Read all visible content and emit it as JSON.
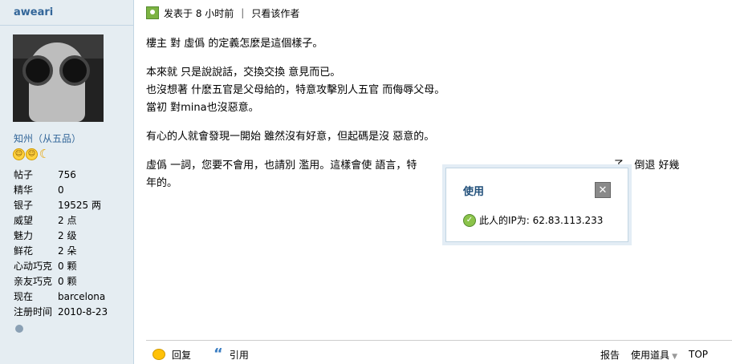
{
  "user": {
    "name": "aweari",
    "rank": "知州（从五品）",
    "stats": [
      {
        "label": "帖子",
        "value": "756"
      },
      {
        "label": "精华",
        "value": "0"
      },
      {
        "label": "银子",
        "value": "19525 两"
      },
      {
        "label": "威望",
        "value": "2 点"
      },
      {
        "label": "魅力",
        "value": "2 级"
      },
      {
        "label": "鲜花",
        "value": "2 朵"
      },
      {
        "label": "心动巧克",
        "value": "0 颗"
      },
      {
        "label": "亲友巧克",
        "value": "0 颗"
      },
      {
        "label": "现在",
        "value": "barcelona"
      },
      {
        "label": "注册时间",
        "value": "2010-8-23"
      }
    ]
  },
  "post": {
    "posted_at": "发表于  8 小时前",
    "separator": "|",
    "author_only": "只看该作者",
    "lines": [
      "樓主  對  虛僞  的定義怎麼是這個樣子。",
      "本來就  只是說說話，交換交換  意見而已。",
      "也沒想著  什麽五官是父母給的，特意攻擊別人五官  而侮辱父母。",
      "當初  對mina也沒惡意。",
      "有心的人就會發現一開始  雖然沒有好意，但起碼是沒  惡意的。",
      "虛僞  一詞，您要不會用，也請別  濫用。這樣會使  語言，特",
      "子，倒退  好幾",
      "年的。"
    ]
  },
  "popup": {
    "title": "使用",
    "close": "✕",
    "ip_text": "此人的IP为: 62.83.113.233"
  },
  "footer": {
    "reply": "回复",
    "quote": "引用",
    "report": "报告",
    "tools": "使用道具",
    "top": "TOP"
  }
}
